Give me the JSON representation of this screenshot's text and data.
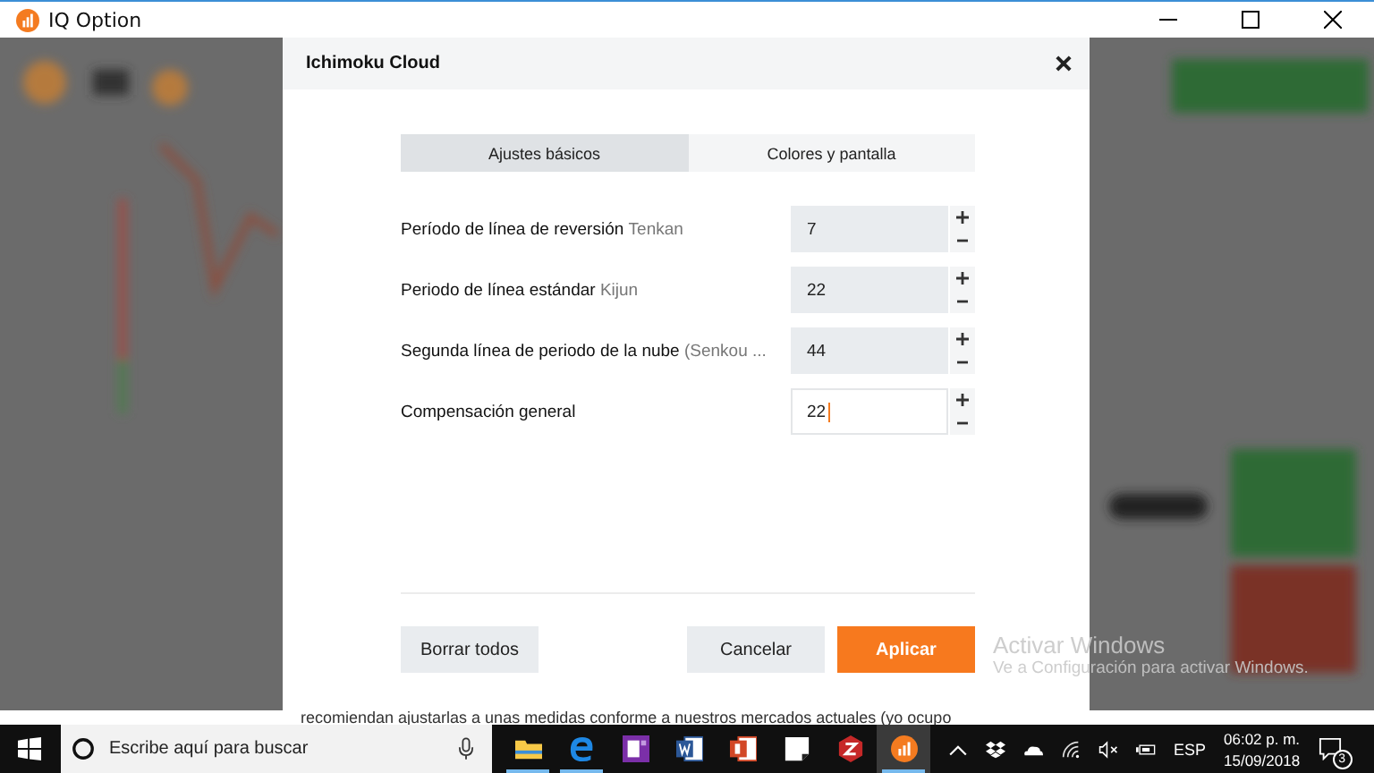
{
  "window": {
    "title": "IQ Option"
  },
  "dialog": {
    "title": "Ichimoku Cloud",
    "tabs": [
      {
        "label": "Ajustes básicos",
        "selected": true
      },
      {
        "label": "Colores y pantalla",
        "selected": false
      }
    ],
    "settings": [
      {
        "label": "Período de línea de reversión",
        "hint": "Tenkan",
        "value": "7",
        "focused": false
      },
      {
        "label": "Periodo de línea estándar",
        "hint": "Kijun",
        "value": "22",
        "focused": false
      },
      {
        "label": "Segunda línea de periodo de la nube",
        "hint": "(Senkou ...",
        "value": "44",
        "focused": false
      },
      {
        "label": "Compensación general",
        "value": "22",
        "focused": true
      }
    ],
    "buttons": [
      {
        "label": "Borrar todos",
        "kind": "secondary"
      },
      {
        "label": "Cancelar",
        "kind": "secondary"
      },
      {
        "label": "Aplicar",
        "kind": "primary"
      }
    ]
  },
  "background_text": "recomiendan ajustarlas a unas medidas conforme a nuestros mercados actuales (yo ocupo",
  "activation_notice": {
    "title": "Activar Windows",
    "message": "Ve a Configuración para activar Windows."
  },
  "taskbar": {
    "search_placeholder": "Escribe aquí para buscar",
    "apps": [
      {
        "kind": "folder",
        "running": true,
        "selected": false
      },
      {
        "kind": "browser",
        "running": true,
        "selected": false
      },
      {
        "kind": "notebook",
        "running": false,
        "selected": false
      },
      {
        "kind": "word",
        "running": false,
        "selected": false
      },
      {
        "kind": "slides",
        "running": false,
        "selected": false
      },
      {
        "kind": "note",
        "running": false,
        "selected": false
      },
      {
        "kind": "z",
        "running": false,
        "selected": false
      },
      {
        "kind": "chart",
        "running": true,
        "selected": true
      }
    ],
    "language": "ESP",
    "time": "06:02 p. m.",
    "date": "15/09/2018",
    "notifications": "3"
  }
}
